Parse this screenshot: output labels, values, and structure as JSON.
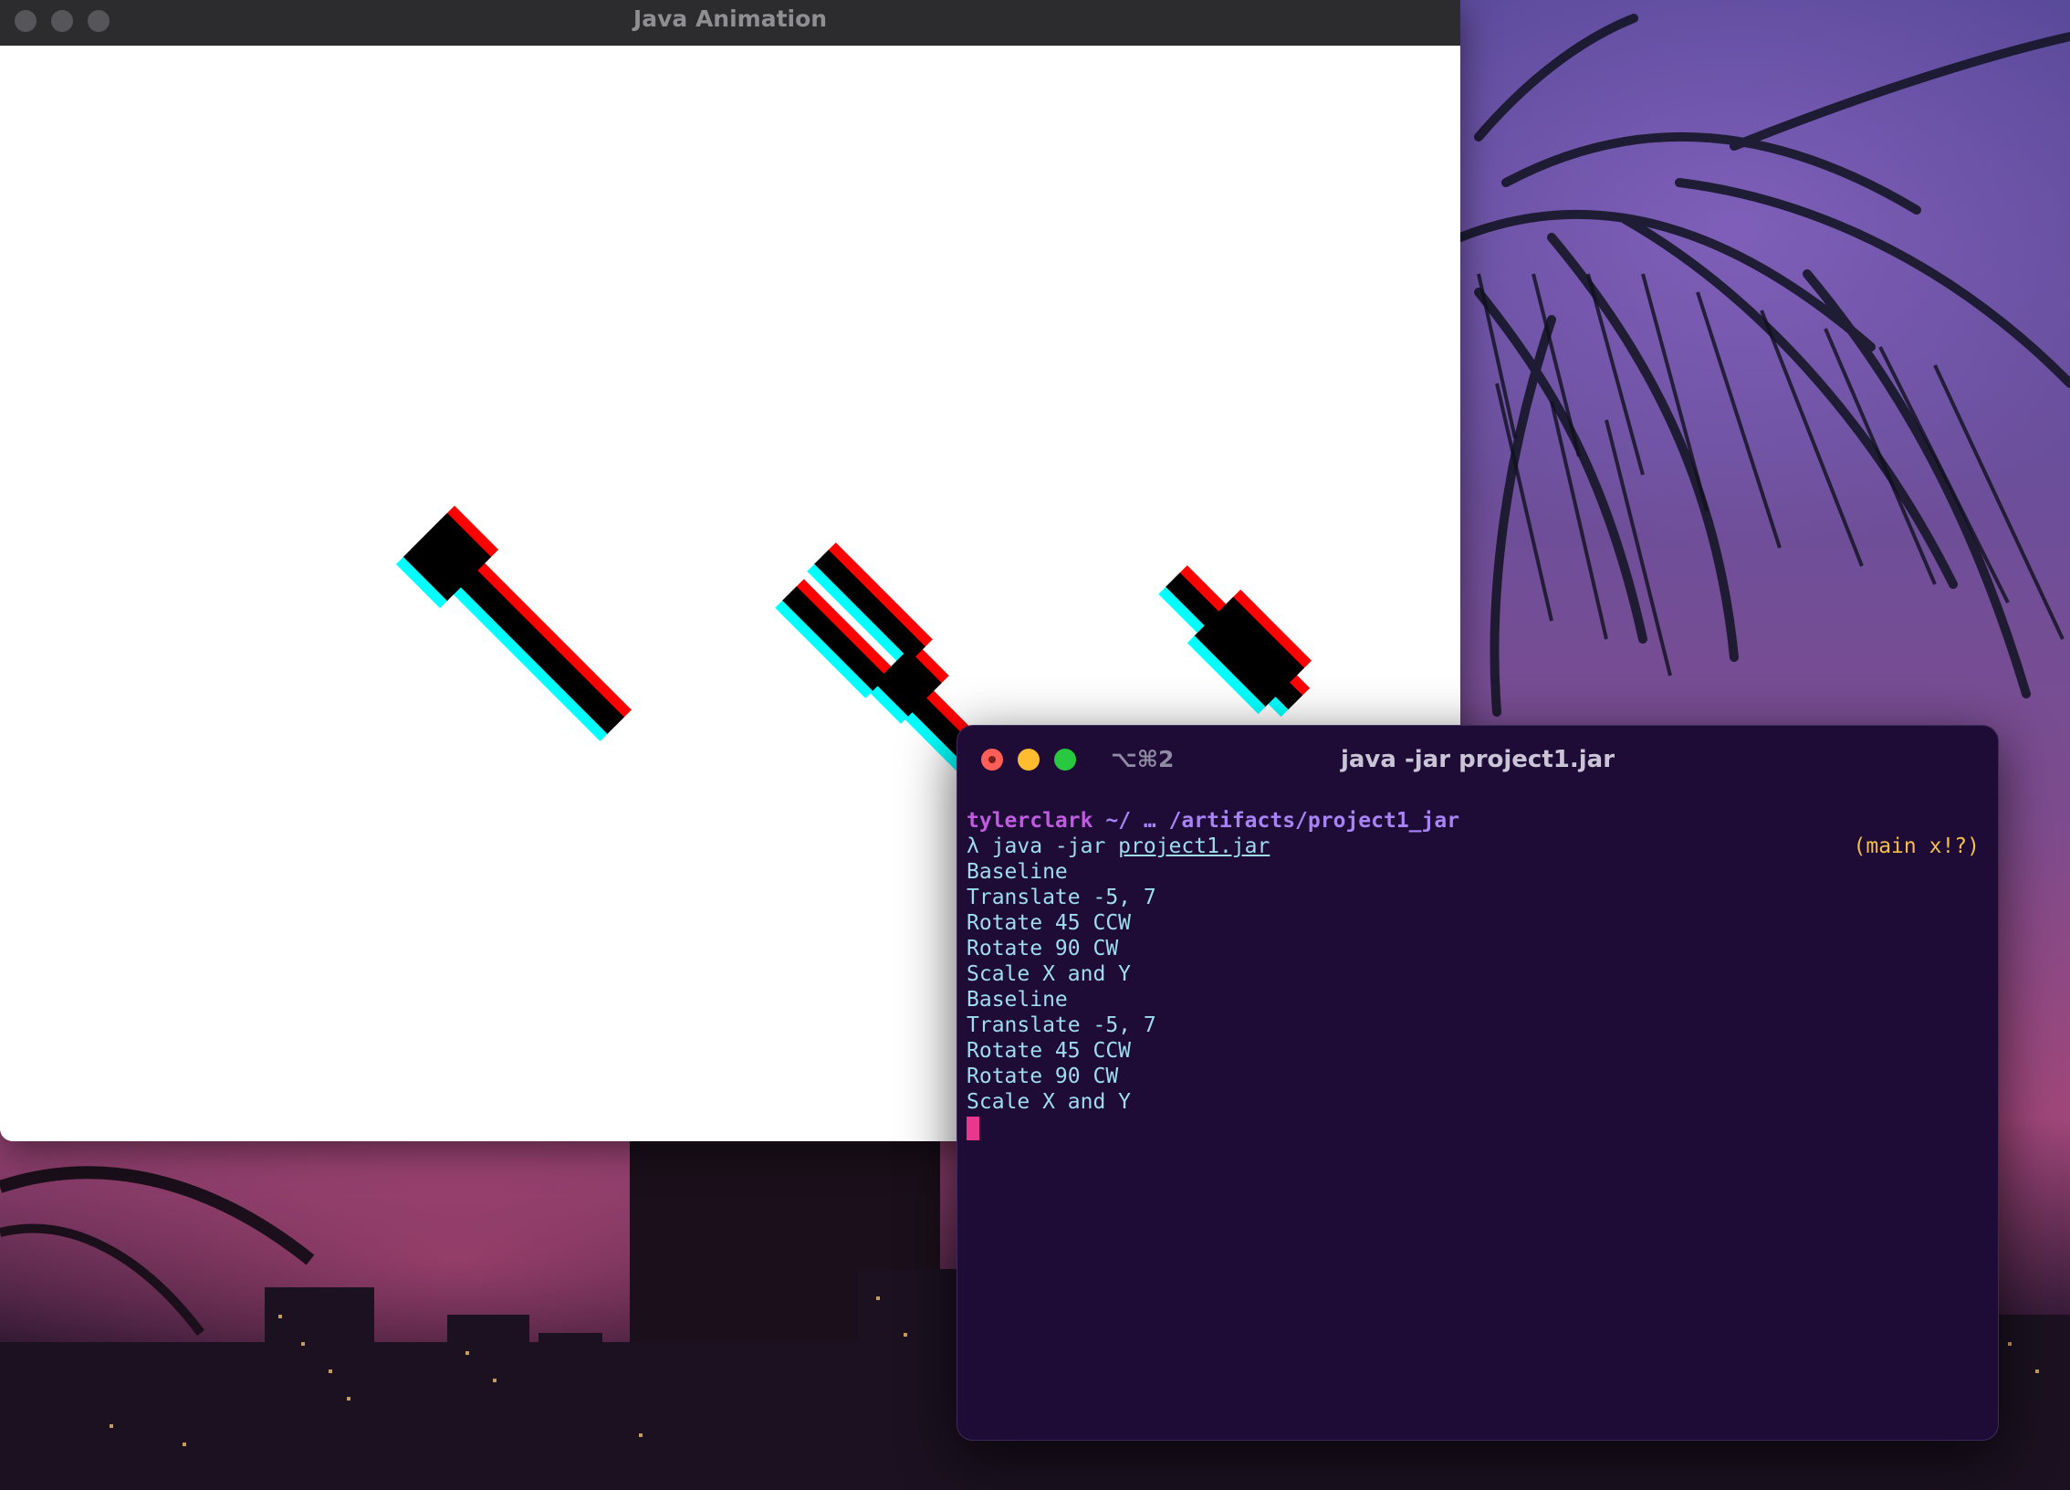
{
  "java_window": {
    "title": "Java Animation"
  },
  "terminal": {
    "shortcut": "⌥⌘2",
    "title": "java -jar project1.jar",
    "prompt_user": "tylerclark",
    "prompt_path": "~/ … /artifacts/project1_jar",
    "command_prefix": "λ java -jar ",
    "command_file": "project1.jar",
    "git_status": "(main x!?)",
    "output": [
      "Baseline",
      "Translate -5, 7",
      "Rotate 45 CCW",
      "Rotate 90 CW",
      "Scale X and Y",
      "Baseline",
      "Translate -5, 7",
      "Rotate 45 CCW",
      "Rotate 90 CW",
      "Scale X and Y"
    ]
  },
  "colors": {
    "terminal_bg": "#1e0b36",
    "shape_red": "#ff0000",
    "shape_cyan": "#00ffff",
    "shape_black": "#000000",
    "cursor": "#e8378d"
  }
}
